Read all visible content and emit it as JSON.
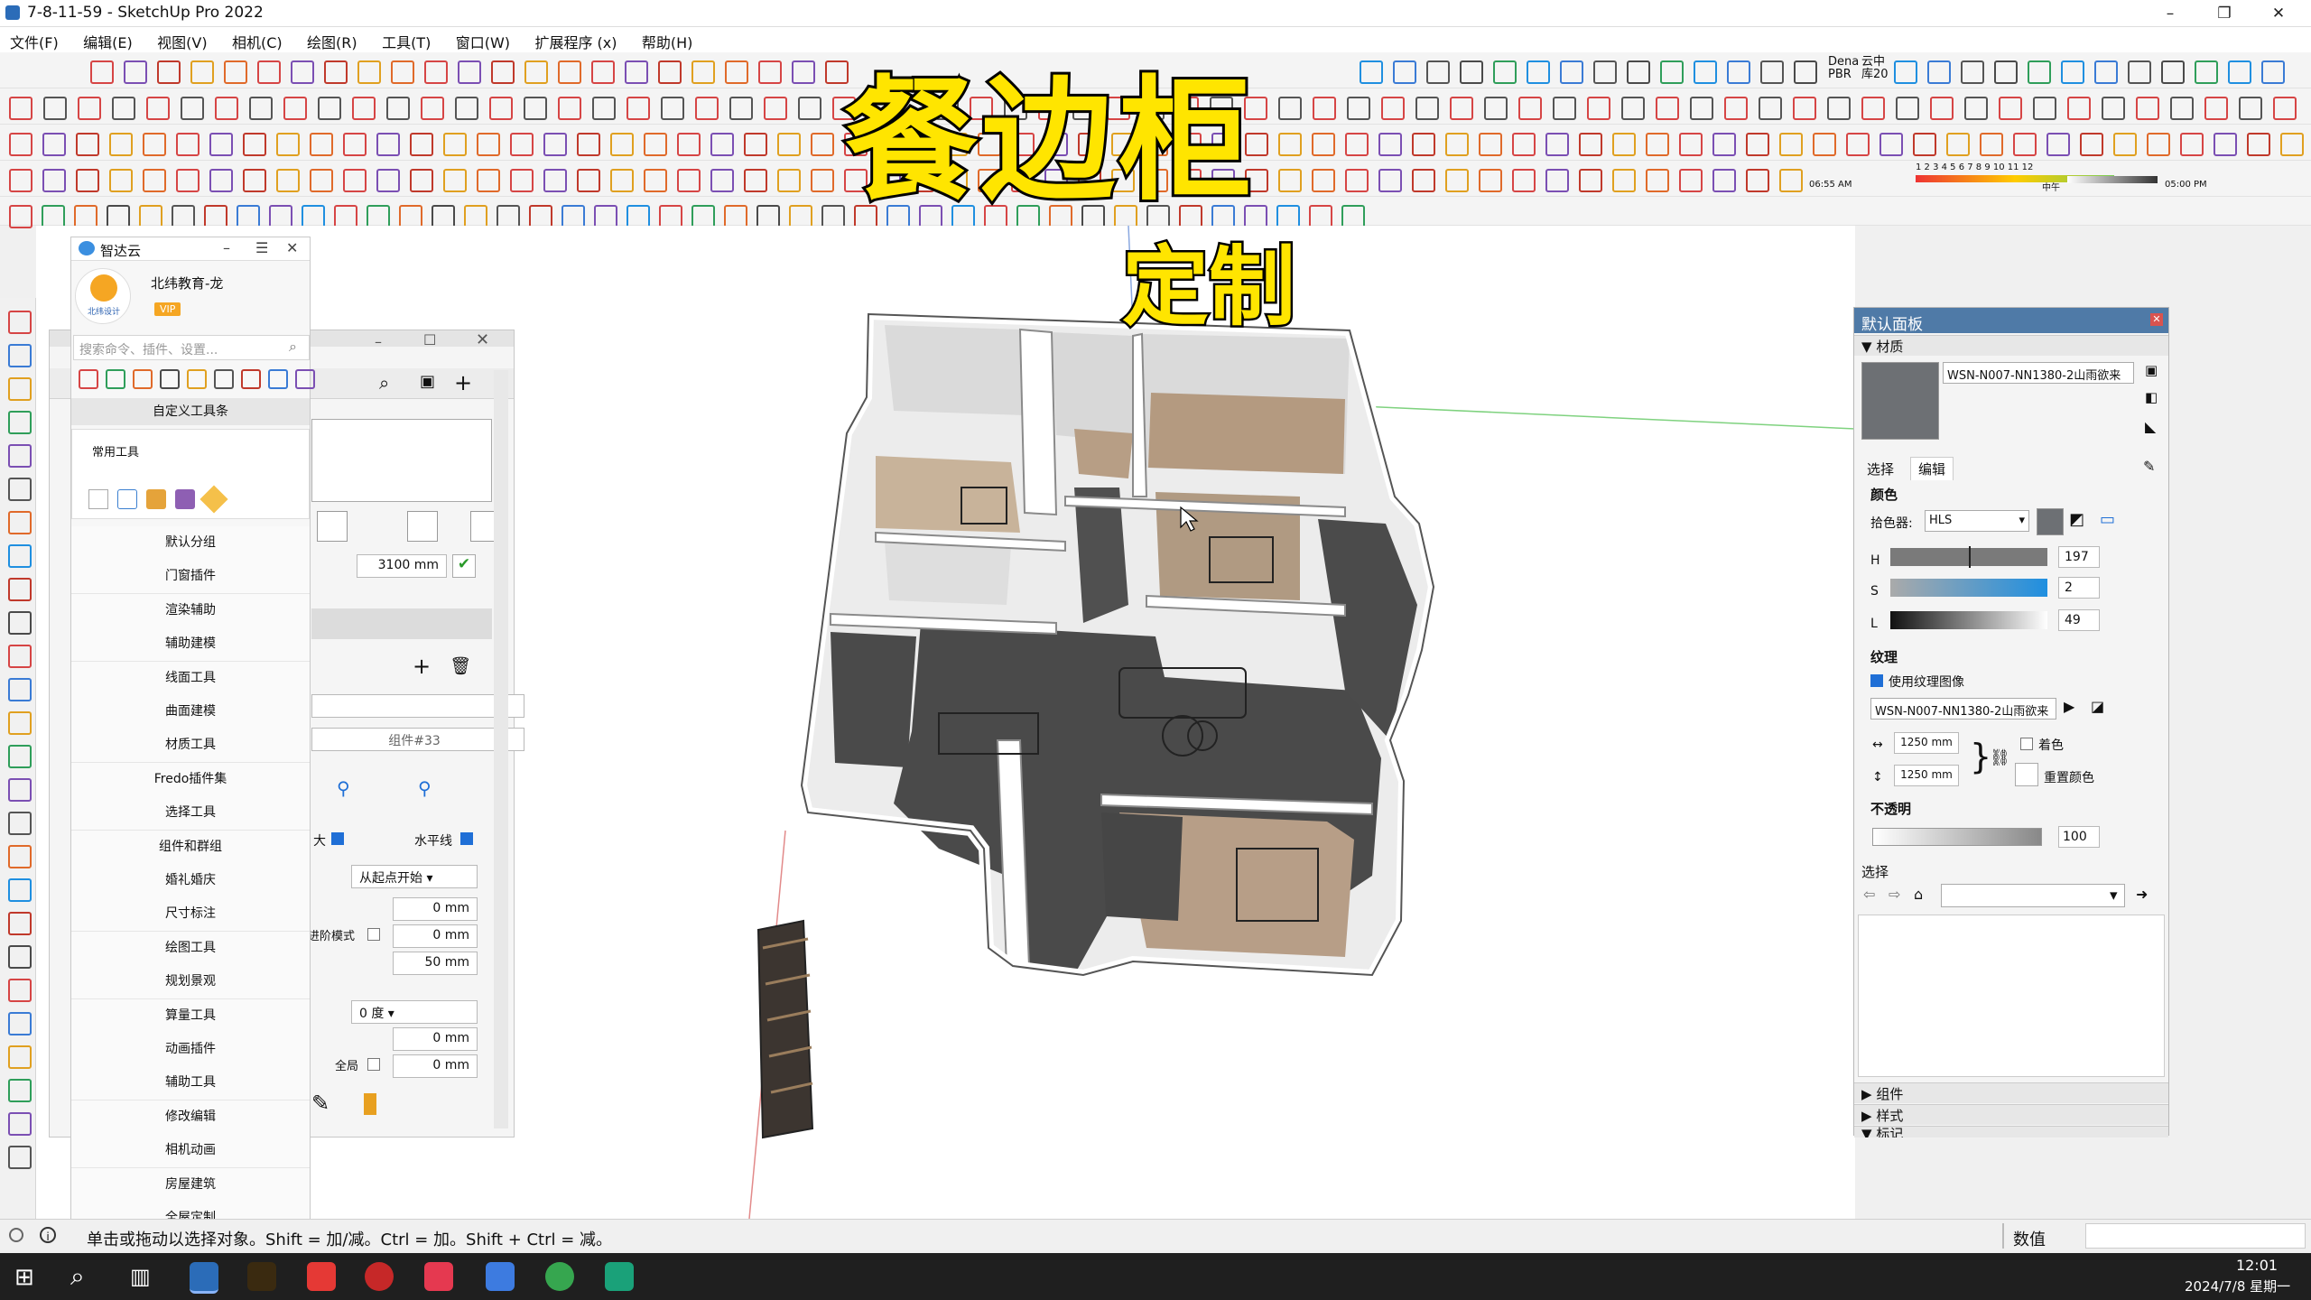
{
  "window": {
    "title": "7-8-11-59 - SketchUp Pro 2022",
    "buttons": [
      "–",
      "❐",
      "✕"
    ]
  },
  "menu": [
    "文件(F)",
    "编辑(E)",
    "视图(V)",
    "相机(C)",
    "绘图(R)",
    "工具(T)",
    "窗口(W)",
    "扩展程序 (x)",
    "帮助(H)"
  ],
  "overlay": {
    "title": "餐边柜",
    "subtitle": "定制"
  },
  "toolbar_labels": {
    "pbr": "Dena PBR",
    "yunzhong": "云中 库20",
    "hours": "1 2 3 4 5 6 7 8 9 10 11 12",
    "time_am": "06:55 AM",
    "noon": "中午",
    "time_pm": "05:00 PM"
  },
  "plugin_panel": {
    "title": "智达云",
    "user": "北纬教育-龙",
    "vip": "VIP",
    "logo_text": "北纬设计",
    "search_placeholder": "搜索命令、插件、设置...",
    "custom_toolbar": "自定义工具条",
    "common_tools": "常用工具",
    "items": [
      "默认分组",
      "门窗插件",
      "渲染辅助",
      "辅助建模",
      "线面工具",
      "曲面建模",
      "材质工具",
      "Fredo插件集",
      "选择工具",
      "组件和群组",
      "婚礼婚庆",
      "尺寸标注",
      "绘图工具",
      "规划景观",
      "算量工具",
      "动画插件",
      "辅助工具",
      "修改编辑",
      "相机动画",
      "房屋建筑",
      "全屋定制"
    ]
  },
  "mid_panel": {
    "length_value": "3100 mm",
    "component_name": "组件#33",
    "label_big": "大",
    "label_horizontal": "水平线",
    "dropdown_start": "从起点开始",
    "label_step_mode": "进阶模式",
    "field_a": "0 mm",
    "field_b": "0 mm",
    "field_c": "50 mm",
    "dropdown_angle": "0 度",
    "field_d": "0 mm",
    "label_global": "全局",
    "field_e": "0 mm"
  },
  "default_panel": {
    "title": "默认面板",
    "materials_header": "材质",
    "material_name": "WSN-N007-NN1380-2山雨欲来",
    "tab_select": "选择",
    "tab_edit": "编辑",
    "color_label": "颜色",
    "picker_label": "拾色器:",
    "picker_mode": "HLS",
    "h_value": "197",
    "s_value": "2",
    "l_value": "49",
    "texture_label": "纹理",
    "use_texture_label": "使用纹理图像",
    "texture_file": "WSN-N007-NN1380-2山雨欲来",
    "width": "1250 mm",
    "height": "1250 mm",
    "colorize_label": "着色",
    "reset_color_label": "重置颜色",
    "opacity_label": "不透明",
    "opacity_value": "100",
    "select_label": "选择",
    "section_components": "组件",
    "section_styles": "样式",
    "section_tags": "标记",
    "colors": {
      "title_bg": "#4f7aa7",
      "swatch": "#6d7074",
      "h_slider": "#7a7a7a",
      "s_slider": "#1f8fe0"
    }
  },
  "status": {
    "hint": "单击或拖动以选择对象。Shift = 加/减。Ctrl = 加。Shift + Ctrl = 减。",
    "measure_label": "数值"
  },
  "taskbar": {
    "time": "12:01",
    "date": "2024/7/8 星期一"
  }
}
